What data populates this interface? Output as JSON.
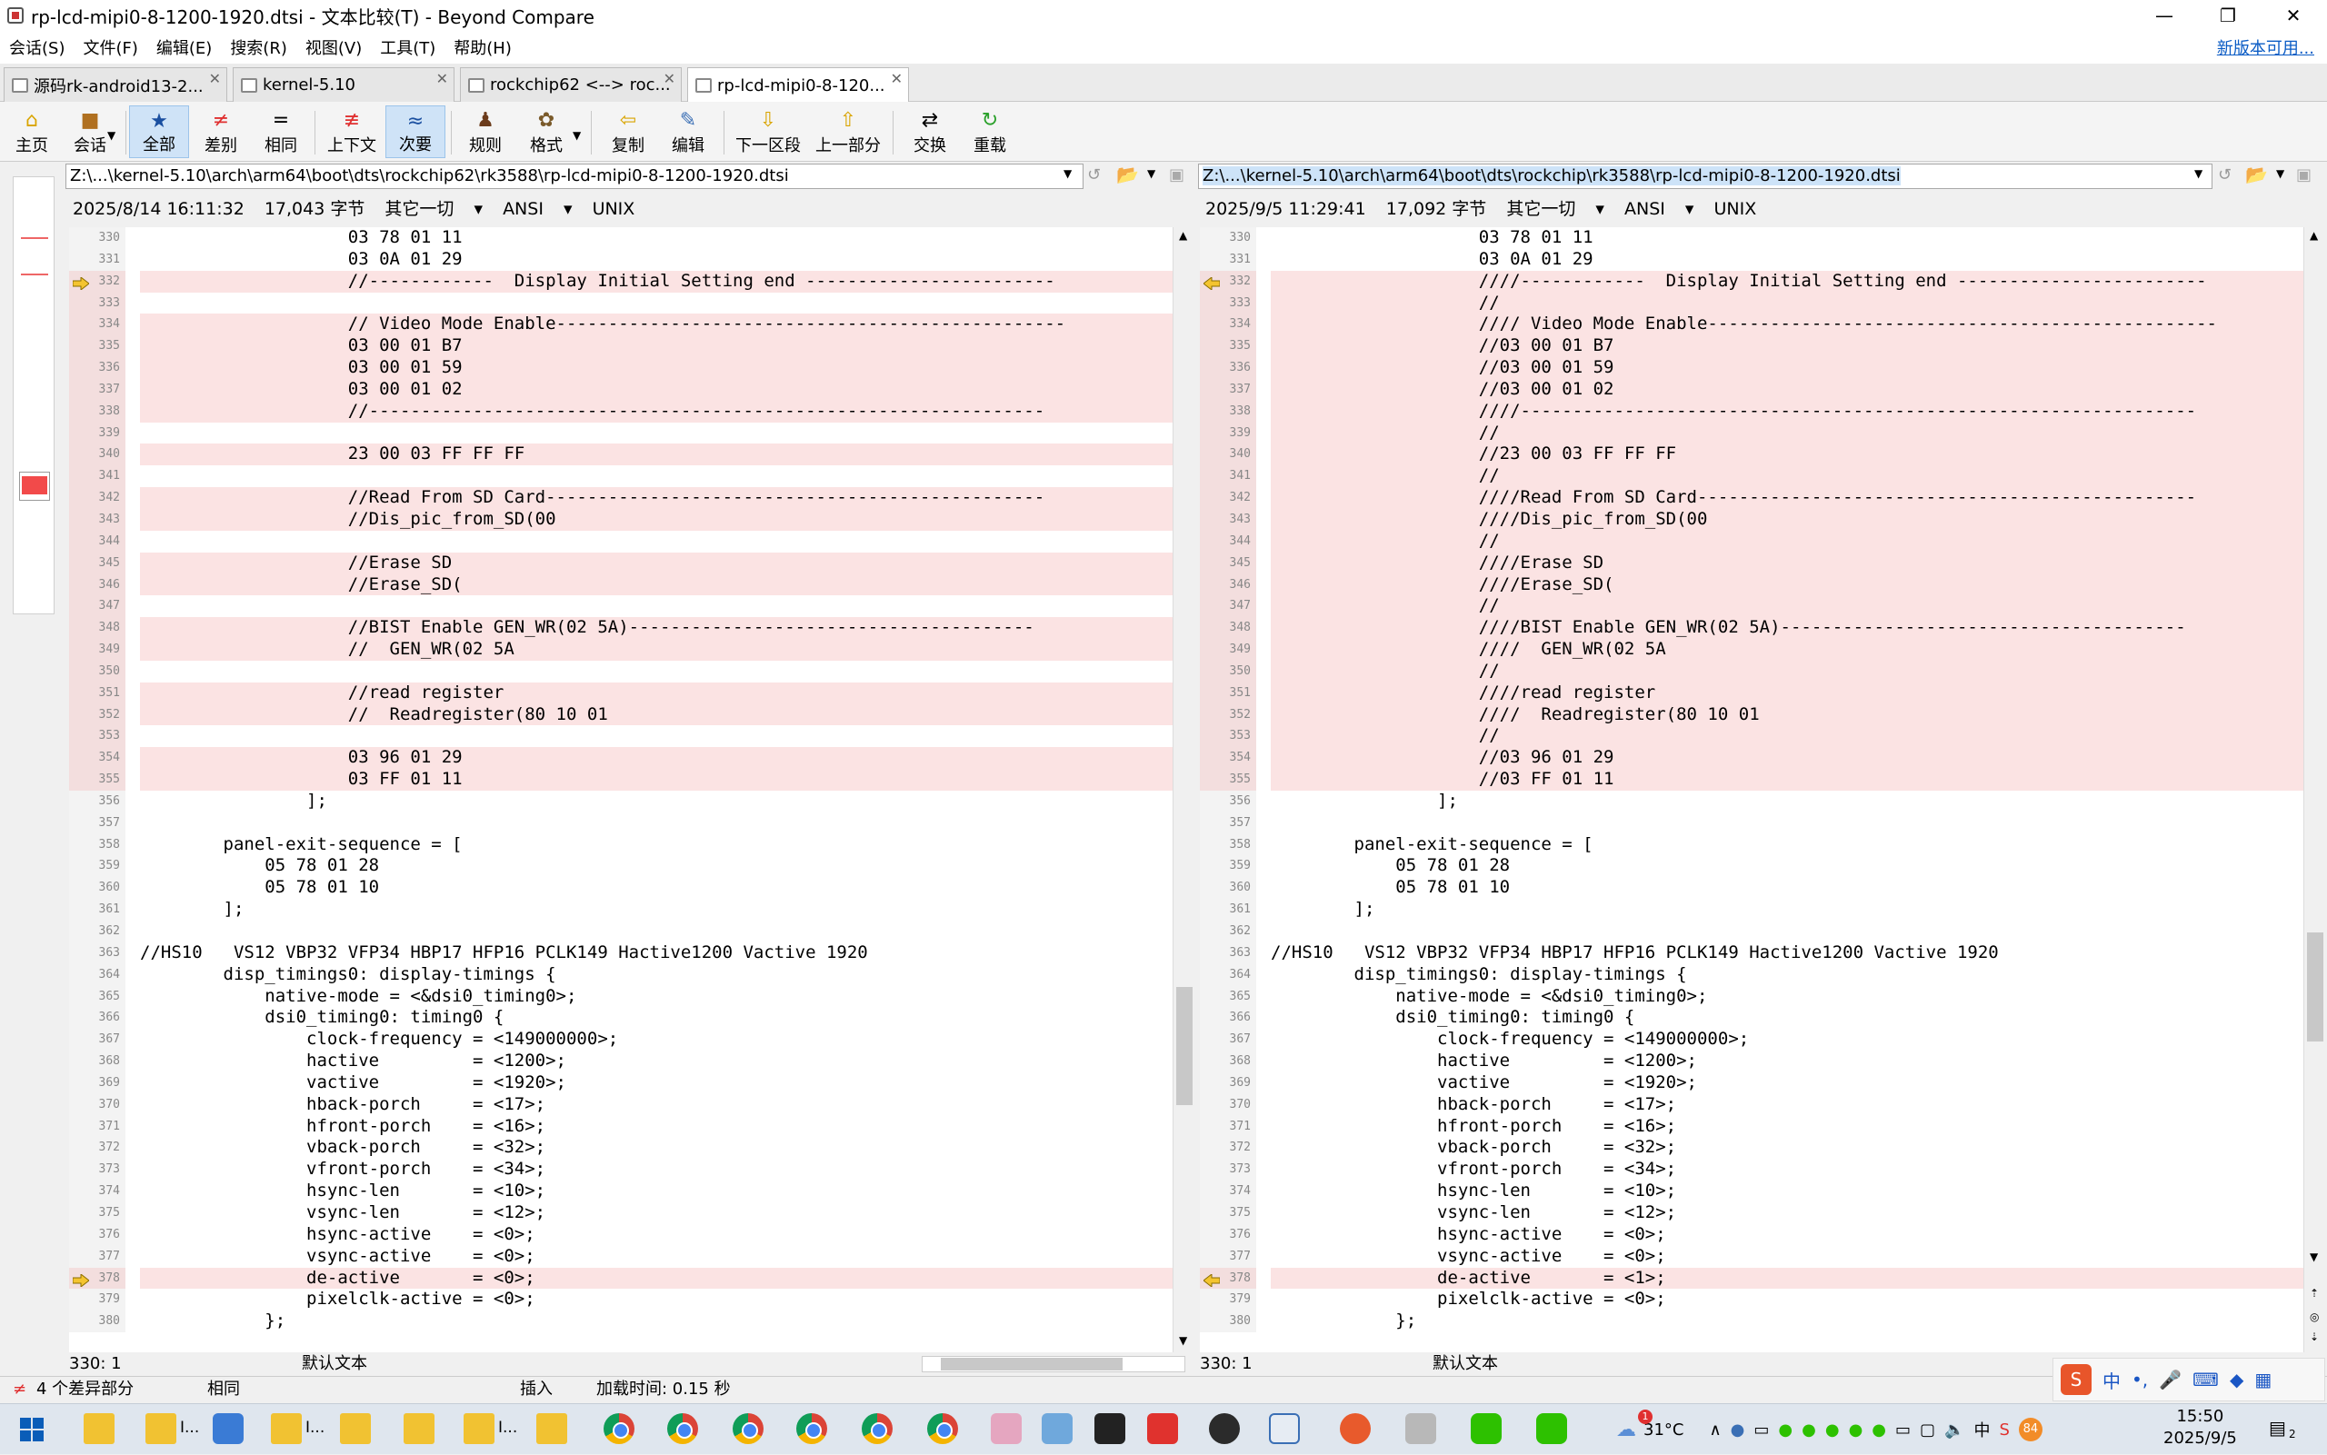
{
  "window": {
    "title": "rp-lcd-mipi0-8-1200-1920.dtsi - 文本比较(T) - Beyond Compare"
  },
  "menu": {
    "items": [
      "会话(S)",
      "文件(F)",
      "编辑(E)",
      "搜索(R)",
      "视图(V)",
      "工具(T)",
      "帮助(H)"
    ],
    "new_version": "新版本可用..."
  },
  "tabs": [
    {
      "label": "源码rk-android13-2..."
    },
    {
      "label": "kernel-5.10"
    },
    {
      "label": "rockchip62 <--> roc..."
    },
    {
      "label": "rp-lcd-mipi0-8-120..."
    }
  ],
  "toolbar": {
    "home": "主页",
    "session": "会话",
    "all": "全部",
    "diff": "差别",
    "same": "相同",
    "context": "上下文",
    "minor": "次要",
    "rules": "规则",
    "format": "格式",
    "copy": "复制",
    "edit": "编辑",
    "next_section": "下一区段",
    "prev_section": "上一部分",
    "swap": "交换",
    "reload": "重载"
  },
  "left": {
    "path": "Z:\\...\\kernel-5.10\\arch\\arm64\\boot\\dts\\rockchip62\\rk3588\\rp-lcd-mipi0-8-1200-1920.dtsi",
    "date": "2025/8/14 16:11:32",
    "size": "17,043 字节",
    "other": "其它一切",
    "encoding": "ANSI",
    "eol": "UNIX",
    "cursor": "330: 1",
    "text_mode": "默认文本"
  },
  "right": {
    "path": "Z:\\...\\kernel-5.10\\arch\\arm64\\boot\\dts\\rockchip\\rk3588\\rp-lcd-mipi0-8-1200-1920.dtsi",
    "date": "2025/9/5 11:29:41",
    "size": "17,092 字节",
    "other": "其它一切",
    "encoding": "ANSI",
    "eol": "UNIX",
    "cursor": "330: 1",
    "text_mode": "默认文本"
  },
  "diff_lines": {
    "left": [
      {
        "n": "330",
        "t": "                    03 78 01 11"
      },
      {
        "n": "331",
        "t": "                    03 0A 01 29"
      },
      {
        "n": "332",
        "t": "                    //------------  Display Initial Setting end ------------------------",
        "d": 1,
        "a": 1
      },
      {
        "n": "333",
        "t": "",
        "d": 1
      },
      {
        "n": "334",
        "t": "                    // Video Mode Enable-------------------------------------------------",
        "d": 1
      },
      {
        "n": "335",
        "t": "                    03 00 01 B7",
        "d": 1
      },
      {
        "n": "336",
        "t": "                    03 00 01 59",
        "d": 1
      },
      {
        "n": "337",
        "t": "                    03 00 01 02",
        "d": 1
      },
      {
        "n": "338",
        "t": "                    //-----------------------------------------------------------------",
        "d": 1
      },
      {
        "n": "339",
        "t": "",
        "d": 1
      },
      {
        "n": "340",
        "t": "                    23 00 03 FF FF FF",
        "d": 1
      },
      {
        "n": "341",
        "t": "",
        "d": 1
      },
      {
        "n": "342",
        "t": "                    //Read From SD Card------------------------------------------------",
        "d": 1
      },
      {
        "n": "343",
        "t": "                    //Dis_pic_from_SD(00",
        "d": 1
      },
      {
        "n": "344",
        "t": "",
        "d": 1
      },
      {
        "n": "345",
        "t": "                    //Erase SD",
        "d": 1
      },
      {
        "n": "346",
        "t": "                    //Erase_SD(",
        "d": 1
      },
      {
        "n": "347",
        "t": "",
        "d": 1
      },
      {
        "n": "348",
        "t": "                    //BIST Enable GEN_WR(02 5A)---------------------------------------",
        "d": 1
      },
      {
        "n": "349",
        "t": "                    //  GEN_WR(02 5A",
        "d": 1
      },
      {
        "n": "350",
        "t": "",
        "d": 1
      },
      {
        "n": "351",
        "t": "                    //read register",
        "d": 1
      },
      {
        "n": "352",
        "t": "                    //  Readregister(80 10 01",
        "d": 1
      },
      {
        "n": "353",
        "t": "",
        "d": 1
      },
      {
        "n": "354",
        "t": "                    03 96 01 29",
        "d": 1
      },
      {
        "n": "355",
        "t": "                    03 FF 01 11",
        "d": 1
      },
      {
        "n": "356",
        "t": "                ];"
      },
      {
        "n": "357",
        "t": ""
      },
      {
        "n": "358",
        "t": "        panel-exit-sequence = ["
      },
      {
        "n": "359",
        "t": "            05 78 01 28"
      },
      {
        "n": "360",
        "t": "            05 78 01 10"
      },
      {
        "n": "361",
        "t": "        ];"
      },
      {
        "n": "362",
        "t": ""
      },
      {
        "n": "363",
        "t": "//HS10   VS12 VBP32 VFP34 HBP17 HFP16 PCLK149 Hactive1200 Vactive 1920"
      },
      {
        "n": "364",
        "t": "        disp_timings0: display-timings {"
      },
      {
        "n": "365",
        "t": "            native-mode = <&dsi0_timing0>;"
      },
      {
        "n": "366",
        "t": "            dsi0_timing0: timing0 {"
      },
      {
        "n": "367",
        "t": "                clock-frequency = <149000000>;"
      },
      {
        "n": "368",
        "t": "                hactive         = <1200>;"
      },
      {
        "n": "369",
        "t": "                vactive         = <1920>;"
      },
      {
        "n": "370",
        "t": "                hback-porch     = <17>;"
      },
      {
        "n": "371",
        "t": "                hfront-porch    = <16>;"
      },
      {
        "n": "372",
        "t": "                vback-porch     = <32>;"
      },
      {
        "n": "373",
        "t": "                vfront-porch    = <34>;"
      },
      {
        "n": "374",
        "t": "                hsync-len       = <10>;"
      },
      {
        "n": "375",
        "t": "                vsync-len       = <12>;"
      },
      {
        "n": "376",
        "t": "                hsync-active    = <0>;"
      },
      {
        "n": "377",
        "t": "                vsync-active    = <0>;"
      },
      {
        "n": "378",
        "t": "                de-active       = <0>;",
        "d": 1,
        "a": 1
      },
      {
        "n": "379",
        "t": "                pixelclk-active = <0>;"
      },
      {
        "n": "380",
        "t": "            };"
      }
    ],
    "right": [
      {
        "n": "330",
        "t": "                    03 78 01 11"
      },
      {
        "n": "331",
        "t": "                    03 0A 01 29"
      },
      {
        "n": "332",
        "t": "                    ////------------  Display Initial Setting end ------------------------",
        "d": 1,
        "a": 1
      },
      {
        "n": "333",
        "t": "                    //",
        "d": 1
      },
      {
        "n": "334",
        "t": "                    //// Video Mode Enable-------------------------------------------------",
        "d": 1
      },
      {
        "n": "335",
        "t": "                    //03 00 01 B7",
        "d": 1
      },
      {
        "n": "336",
        "t": "                    //03 00 01 59",
        "d": 1
      },
      {
        "n": "337",
        "t": "                    //03 00 01 02",
        "d": 1
      },
      {
        "n": "338",
        "t": "                    ////-----------------------------------------------------------------",
        "d": 1
      },
      {
        "n": "339",
        "t": "                    //",
        "d": 1
      },
      {
        "n": "340",
        "t": "                    //23 00 03 FF FF FF",
        "d": 1
      },
      {
        "n": "341",
        "t": "                    //",
        "d": 1
      },
      {
        "n": "342",
        "t": "                    ////Read From SD Card------------------------------------------------",
        "d": 1
      },
      {
        "n": "343",
        "t": "                    ////Dis_pic_from_SD(00",
        "d": 1
      },
      {
        "n": "344",
        "t": "                    //",
        "d": 1
      },
      {
        "n": "345",
        "t": "                    ////Erase SD",
        "d": 1
      },
      {
        "n": "346",
        "t": "                    ////Erase_SD(",
        "d": 1
      },
      {
        "n": "347",
        "t": "                    //",
        "d": 1
      },
      {
        "n": "348",
        "t": "                    ////BIST Enable GEN_WR(02 5A)---------------------------------------",
        "d": 1
      },
      {
        "n": "349",
        "t": "                    ////  GEN_WR(02 5A",
        "d": 1
      },
      {
        "n": "350",
        "t": "                    //",
        "d": 1
      },
      {
        "n": "351",
        "t": "                    ////read register",
        "d": 1
      },
      {
        "n": "352",
        "t": "                    ////  Readregister(80 10 01",
        "d": 1
      },
      {
        "n": "353",
        "t": "                    //",
        "d": 1
      },
      {
        "n": "354",
        "t": "                    //03 96 01 29",
        "d": 1
      },
      {
        "n": "355",
        "t": "                    //03 FF 01 11",
        "d": 1
      },
      {
        "n": "356",
        "t": "                ];"
      },
      {
        "n": "357",
        "t": ""
      },
      {
        "n": "358",
        "t": "        panel-exit-sequence = ["
      },
      {
        "n": "359",
        "t": "            05 78 01 28"
      },
      {
        "n": "360",
        "t": "            05 78 01 10"
      },
      {
        "n": "361",
        "t": "        ];"
      },
      {
        "n": "362",
        "t": ""
      },
      {
        "n": "363",
        "t": "//HS10   VS12 VBP32 VFP34 HBP17 HFP16 PCLK149 Hactive1200 Vactive 1920"
      },
      {
        "n": "364",
        "t": "        disp_timings0: display-timings {"
      },
      {
        "n": "365",
        "t": "            native-mode = <&dsi0_timing0>;"
      },
      {
        "n": "366",
        "t": "            dsi0_timing0: timing0 {"
      },
      {
        "n": "367",
        "t": "                clock-frequency = <149000000>;"
      },
      {
        "n": "368",
        "t": "                hactive         = <1200>;"
      },
      {
        "n": "369",
        "t": "                vactive         = <1920>;"
      },
      {
        "n": "370",
        "t": "                hback-porch     = <17>;"
      },
      {
        "n": "371",
        "t": "                hfront-porch    = <16>;"
      },
      {
        "n": "372",
        "t": "                vback-porch     = <32>;"
      },
      {
        "n": "373",
        "t": "                vfront-porch    = <34>;"
      },
      {
        "n": "374",
        "t": "                hsync-len       = <10>;"
      },
      {
        "n": "375",
        "t": "                vsync-len       = <12>;"
      },
      {
        "n": "376",
        "t": "                hsync-active    = <0>;"
      },
      {
        "n": "377",
        "t": "                vsync-active    = <0>;"
      },
      {
        "n": "378",
        "t": "                de-active       = <1>;",
        "d": 1,
        "a": 1
      },
      {
        "n": "379",
        "t": "                pixelclk-active = <0>;"
      },
      {
        "n": "380",
        "t": "            };"
      }
    ]
  },
  "status": {
    "diff_count": "4 个差异部分",
    "same": "相同",
    "insert": "插入",
    "load_time": "加载时间: 0.15 秒"
  },
  "taskbar": {
    "temp": "31°C",
    "time": "15:50",
    "date": "2025/9/5",
    "ime": "中",
    "notif": "1",
    "badge84": "84",
    "notif_count": "2",
    "pinned_label": "I..."
  },
  "colors": {
    "diff_bg": "#fbe3e3",
    "accent": "#0b5cc5",
    "diff_text": "#e03030"
  }
}
